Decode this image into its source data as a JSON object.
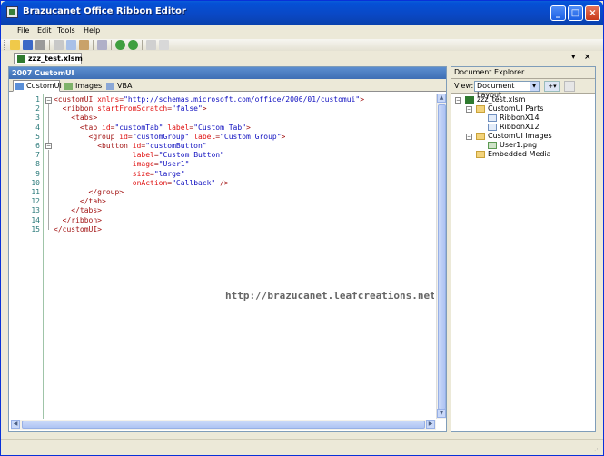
{
  "window": {
    "title": "Brazucanet Office Ribbon Editor"
  },
  "menu": [
    "File",
    "Edit",
    "Tools",
    "Help"
  ],
  "document_tab": {
    "label": "zzz_test.xlsm"
  },
  "left_panel": {
    "title": "2007 CustomUI",
    "tabs": [
      "CustomUI",
      "Images",
      "VBA Callbacks"
    ]
  },
  "editor": {
    "line_numbers": [
      "1",
      "2",
      "3",
      "4",
      "5",
      "6",
      "7",
      "8",
      "9",
      "10",
      "11",
      "12",
      "13",
      "14",
      "15"
    ],
    "lines": [
      {
        "indent": 0,
        "parts": [
          [
            "tag",
            "<customUI "
          ],
          [
            "attr",
            "xmlns"
          ],
          [
            "tag",
            "="
          ],
          [
            "val",
            "\"http://schemas.microsoft.com/office/2006/01/customui\""
          ],
          [
            "tag",
            ">"
          ]
        ]
      },
      {
        "indent": 2,
        "parts": [
          [
            "tag",
            "<ribbon "
          ],
          [
            "attr",
            "startFromScratch"
          ],
          [
            "tag",
            "="
          ],
          [
            "val",
            "\"false\""
          ],
          [
            "tag",
            ">"
          ]
        ]
      },
      {
        "indent": 4,
        "parts": [
          [
            "tag",
            "<tabs>"
          ]
        ]
      },
      {
        "indent": 6,
        "parts": [
          [
            "tag",
            "<tab "
          ],
          [
            "attr",
            "id"
          ],
          [
            "tag",
            "="
          ],
          [
            "val",
            "\"customTab\""
          ],
          [
            "tag",
            " "
          ],
          [
            "attr",
            "label"
          ],
          [
            "tag",
            "="
          ],
          [
            "val",
            "\"Custom Tab\""
          ],
          [
            "tag",
            ">"
          ]
        ]
      },
      {
        "indent": 8,
        "parts": [
          [
            "tag",
            "<group "
          ],
          [
            "attr",
            "id"
          ],
          [
            "tag",
            "="
          ],
          [
            "val",
            "\"customGroup\""
          ],
          [
            "tag",
            " "
          ],
          [
            "attr",
            "label"
          ],
          [
            "tag",
            "="
          ],
          [
            "val",
            "\"Custom Group\""
          ],
          [
            "tag",
            ">"
          ]
        ]
      },
      {
        "indent": 10,
        "parts": [
          [
            "tag",
            "<button "
          ],
          [
            "attr",
            "id"
          ],
          [
            "tag",
            "="
          ],
          [
            "val",
            "\"customButton\""
          ]
        ]
      },
      {
        "indent": 18,
        "parts": [
          [
            "attr",
            "label"
          ],
          [
            "tag",
            "="
          ],
          [
            "val",
            "\"Custom Button\""
          ]
        ]
      },
      {
        "indent": 18,
        "parts": [
          [
            "attr",
            "image"
          ],
          [
            "tag",
            "="
          ],
          [
            "val",
            "\"User1\""
          ]
        ]
      },
      {
        "indent": 18,
        "parts": [
          [
            "attr",
            "size"
          ],
          [
            "tag",
            "="
          ],
          [
            "val",
            "\"large\""
          ]
        ]
      },
      {
        "indent": 18,
        "parts": [
          [
            "attr",
            "onAction"
          ],
          [
            "tag",
            "="
          ],
          [
            "val",
            "\"Callback\""
          ],
          [
            "tag",
            " />"
          ]
        ]
      },
      {
        "indent": 8,
        "parts": [
          [
            "tag",
            "</group>"
          ]
        ]
      },
      {
        "indent": 6,
        "parts": [
          [
            "tag",
            "</tab>"
          ]
        ]
      },
      {
        "indent": 4,
        "parts": [
          [
            "tag",
            "</tabs>"
          ]
        ]
      },
      {
        "indent": 2,
        "parts": [
          [
            "tag",
            "</ribbon>"
          ]
        ]
      },
      {
        "indent": 0,
        "parts": [
          [
            "tag",
            "</customUI>"
          ]
        ]
      }
    ],
    "watermark": "http://brazucanet.leafcreations.net"
  },
  "document_explorer": {
    "title": "Document Explorer",
    "view_label": "View:",
    "view_value": "Document Layout",
    "tree": {
      "root": "zzz_test.xlsm",
      "customui_parts": "CustomUI Parts",
      "part1": "RibbonX14",
      "part2": "RibbonX12",
      "customui_images": "CustomUI Images",
      "image1": "User1.png",
      "embedded_media": "Embedded Media"
    }
  },
  "colors": {
    "title_bar": "#0a48c4",
    "tag": "#a31515",
    "attribute": "#e01010",
    "value": "#1010c0",
    "line_number": "#2b7a7a"
  }
}
